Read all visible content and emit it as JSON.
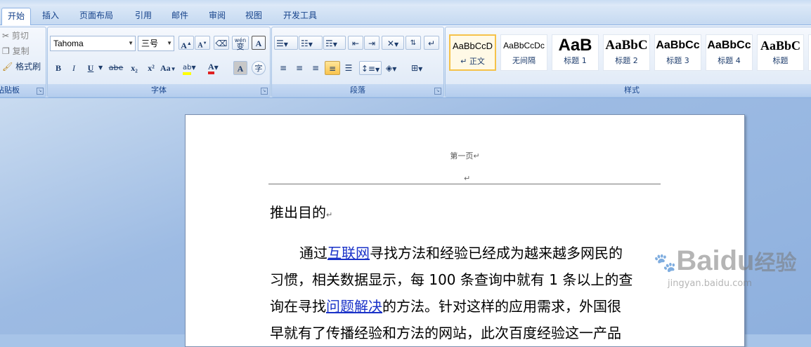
{
  "tabs": [
    {
      "label": "开始",
      "active": true
    },
    {
      "label": "插入"
    },
    {
      "label": "页面布局"
    },
    {
      "label": "引用"
    },
    {
      "label": "邮件"
    },
    {
      "label": "审阅"
    },
    {
      "label": "视图"
    },
    {
      "label": "开发工具"
    }
  ],
  "clipboard": {
    "cut": "剪切",
    "copy": "复制",
    "format_painter": "格式刷",
    "group_label": "粘贴板"
  },
  "font": {
    "family": "Tahoma",
    "size": "三号",
    "group_label": "字体",
    "grow": "A",
    "shrink": "A",
    "phonetic": "wén",
    "phonetic_char": "变",
    "border_char": "A",
    "bold": "B",
    "italic": "I",
    "underline": "U",
    "strike": "abe",
    "subscript": "x₂",
    "superscript": "x²",
    "change_case": "Aa",
    "highlight": "ab",
    "font_color": "A",
    "shading_char": "A",
    "enclose_char": "字"
  },
  "paragraph": {
    "group_label": "段落"
  },
  "styles": {
    "group_label": "样式",
    "items": [
      {
        "sample": "AaBbCcD",
        "name": "↵ 正文",
        "selected": true
      },
      {
        "sample": "AaBbCcDc",
        "name": "无间隔"
      },
      {
        "sample": "AaB",
        "name": "标题 1"
      },
      {
        "sample": "AaBbC",
        "name": "标题 2"
      },
      {
        "sample": "AaBbCc",
        "name": "标题 3"
      },
      {
        "sample": "AaBbCc",
        "name": "标题 4"
      },
      {
        "sample": "AaBbC",
        "name": "标题"
      }
    ]
  },
  "document": {
    "header_text": "第一页",
    "para_mark": "↵",
    "heading": "推出目的",
    "para_lines": [
      {
        "pre": "通过",
        "link": "互联网",
        "post": "寻找方法和经验已经成为越来越多网民的"
      },
      {
        "pre": "习惯，相关数据显示，每 100 条查询中就有 1 条以上的查",
        "link": "",
        "post": ""
      },
      {
        "pre": "询在寻找",
        "link": "问题解决",
        "post": "的方法。针对这样的应用需求，外国很"
      },
      {
        "pre": "早就有了传播经验和方法的网站，此次百度经验这一产品",
        "link": "",
        "post": ""
      }
    ]
  },
  "watermark": {
    "brand": "Baidu",
    "label": "经验",
    "url": "jingyan.baidu.com"
  },
  "colors": {
    "accent": "#15428b",
    "link": "#1a32c8",
    "highlight": "#ffff00",
    "font_color_bar": "#e02020"
  }
}
